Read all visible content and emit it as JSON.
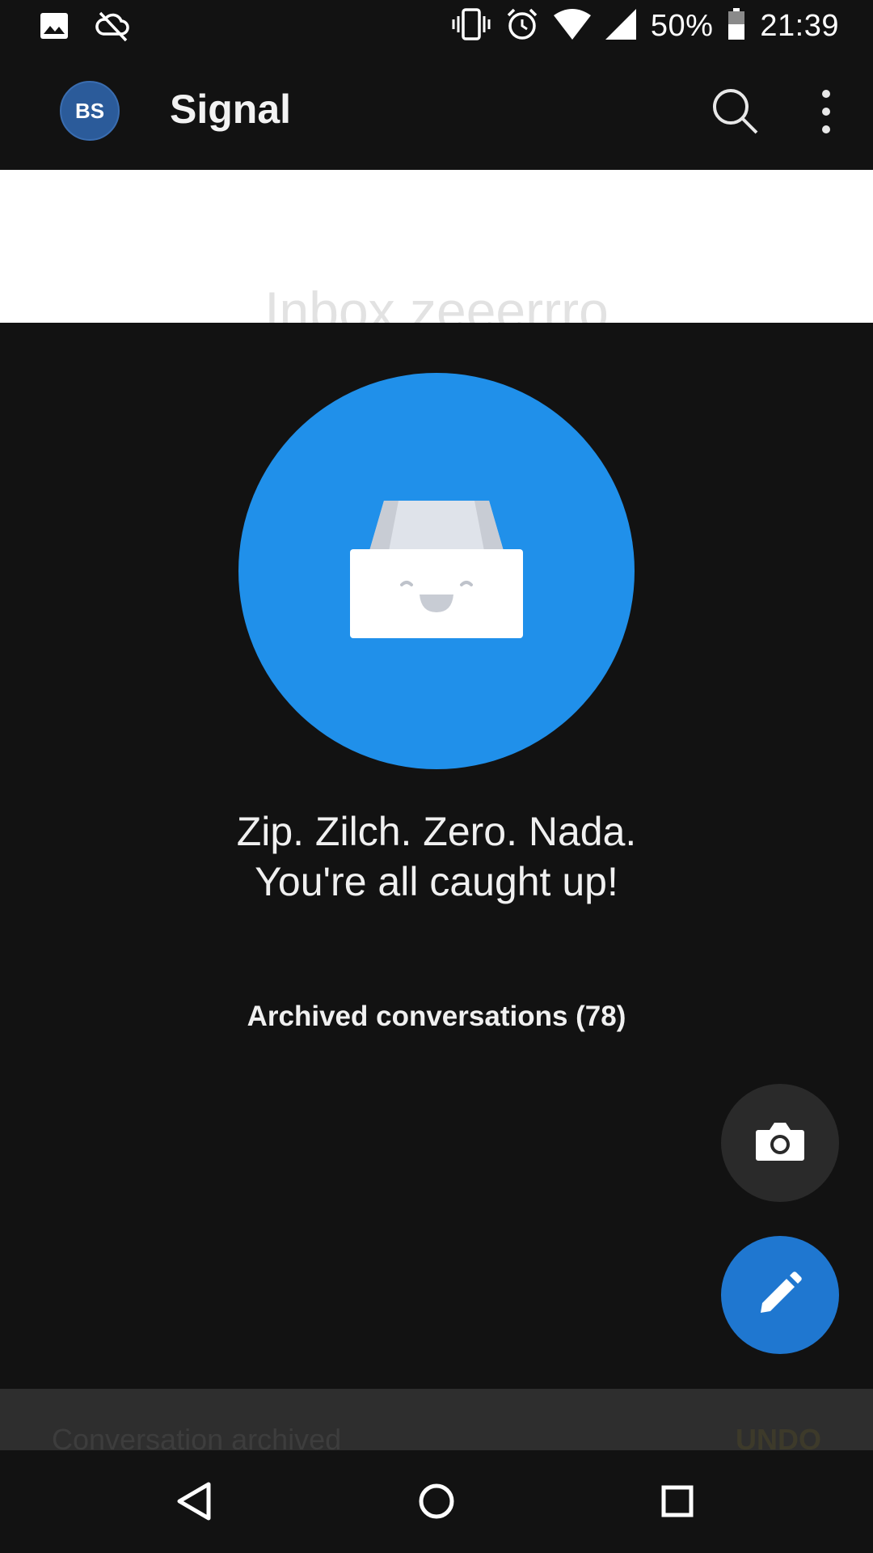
{
  "status_bar": {
    "battery": "50%",
    "time": "21:39"
  },
  "app_bar": {
    "avatar_initials": "BS",
    "title": "Signal"
  },
  "banner": {
    "text": "Inbox zeeerrro"
  },
  "empty_state": {
    "line1": "Zip. Zilch. Zero. Nada.",
    "line2": "You're all caught up!",
    "archived_link": "Archived conversations (78)"
  },
  "snackbar": {
    "message": "Conversation archived",
    "action": "UNDO"
  },
  "icons": {
    "status_left": [
      "image-icon",
      "sync-off-icon"
    ],
    "status_right": [
      "vibrate-icon",
      "alarm-icon",
      "wifi-icon",
      "signal-icon",
      "battery-icon"
    ],
    "app_bar": [
      "search-icon",
      "more-vert-icon"
    ],
    "fabs": [
      "camera-icon",
      "pencil-icon"
    ],
    "nav": [
      "back-icon",
      "home-icon",
      "recents-icon"
    ]
  },
  "colors": {
    "background": "#121212",
    "accent": "#2090ea",
    "compose_fab": "#1f77d0",
    "avatar": "#2b5b9a"
  }
}
